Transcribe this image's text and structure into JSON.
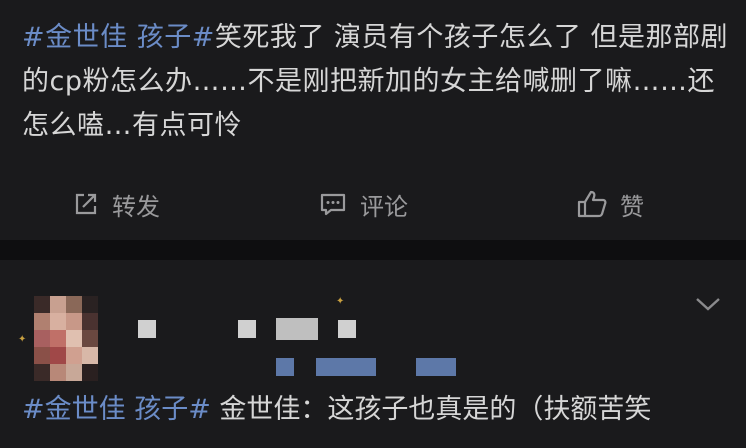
{
  "post": {
    "hashtag": "#金世佳 孩子#",
    "text": "笑死我了 演员有个孩子怎么了 但是那部剧的cp粉怎么办……不是刚把新加的女主给喊删了嘛……还怎么嗑…有点可怜"
  },
  "actions": {
    "repost_label": "转发",
    "comment_label": "评论",
    "like_label": "赞"
  },
  "comment": {
    "hashtag": "#金世佳 孩子#",
    "text": " 金世佳：这孩子也真是的（扶额苦笑"
  },
  "colors": {
    "background": "#151517",
    "card": "#1a1a1c",
    "hashtag": "#6b8cc7",
    "text": "#d6d6d6",
    "muted": "#9a9a9c"
  },
  "icons": {
    "repost": "repost-icon",
    "comment": "comment-icon",
    "like": "thumbs-up-icon",
    "more": "chevron-down-icon"
  }
}
